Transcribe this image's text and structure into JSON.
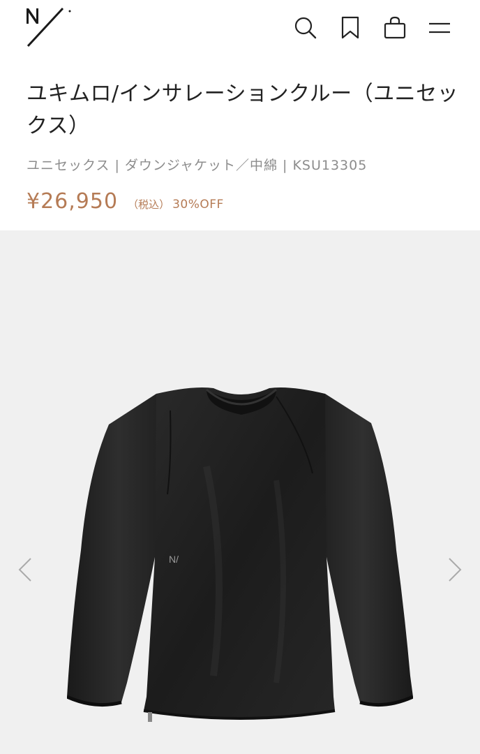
{
  "header": {
    "logo_icon": "brand-logo-icon",
    "icons": [
      "search-icon",
      "bookmark-icon",
      "shopping-bag-icon",
      "menu-icon"
    ]
  },
  "product": {
    "title": "ユキムロ/インサレーションクルー（ユニセックス）",
    "meta": "ユニセックス | ダウンジャケット／中綿 | KSU13305",
    "price": "¥26,950",
    "tax_label": "（税込）",
    "discount": "30%OFF"
  },
  "gallery": {
    "prev_icon": "chevron-left-icon",
    "next_icon": "chevron-right-icon",
    "image": "black-insulation-crew-pullover"
  },
  "colors": {
    "price": "#b57b55",
    "meta": "#8c8c8c",
    "gallery_bg": "#f0f0f0"
  }
}
